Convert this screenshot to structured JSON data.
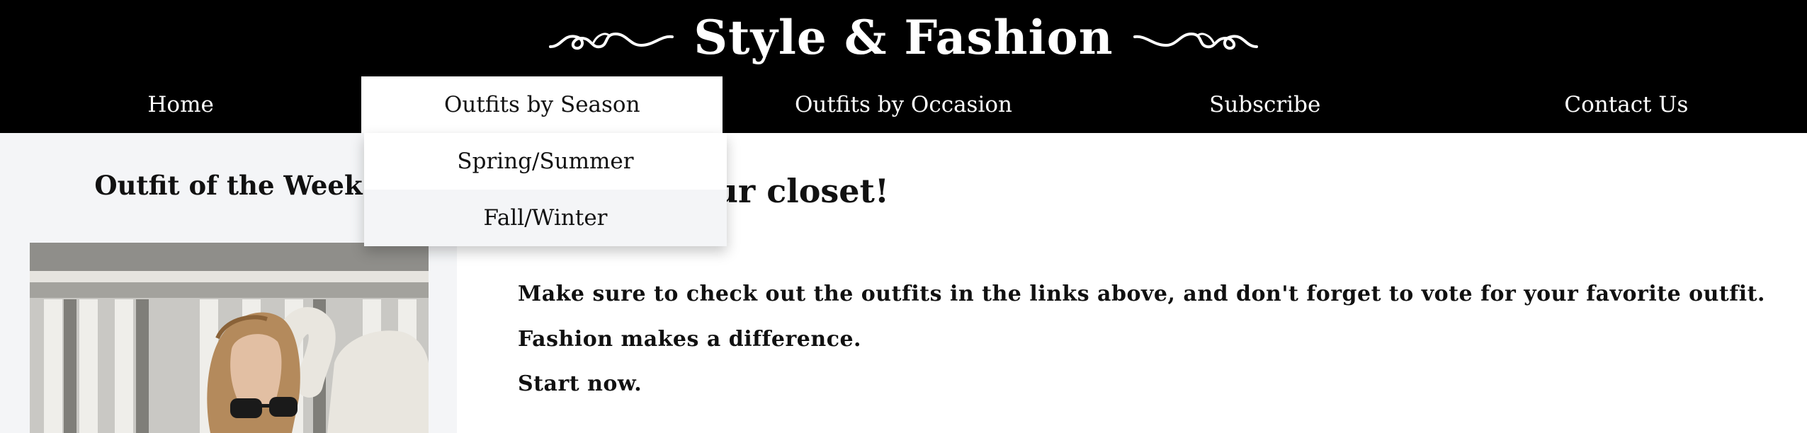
{
  "brand": {
    "title": "Style & Fashion"
  },
  "nav": {
    "items": [
      {
        "label": "Home"
      },
      {
        "label": "Outfits by Season"
      },
      {
        "label": "Outfits by Occasion"
      },
      {
        "label": "Subscribe"
      },
      {
        "label": "Contact Us"
      }
    ],
    "active_index": 1
  },
  "dropdown": {
    "items": [
      {
        "label": "Spring/Summer"
      },
      {
        "label": "Fall/Winter"
      }
    ],
    "hover_index": 1
  },
  "sidebar": {
    "title": "Outfit of the Week"
  },
  "main": {
    "heading": "Refresh your closet!",
    "lines": [
      "Make sure to check out the outfits in the links above, and don't forget to vote for your favorite outfit.",
      "Fashion makes a difference.",
      "Start now."
    ]
  },
  "colors": {
    "header_bg": "#000000",
    "sidebar_bg": "#f4f5f7",
    "text": "#111111"
  }
}
